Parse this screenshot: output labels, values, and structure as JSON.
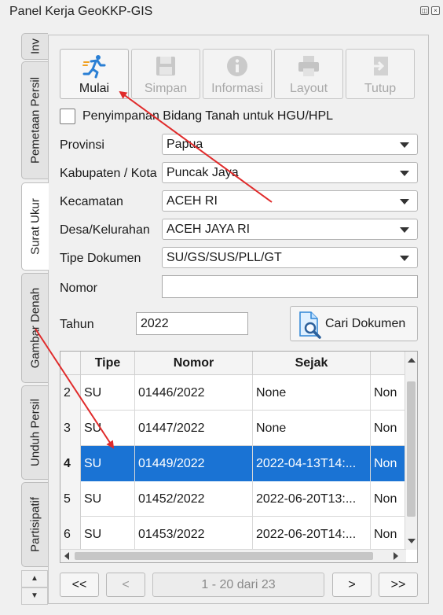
{
  "window": {
    "title": "Panel Kerja GeoKKP-GIS"
  },
  "tabs": [
    {
      "label": "Inv"
    },
    {
      "label": "Pemetaan Persil"
    },
    {
      "label": "Surat Ukur"
    },
    {
      "label": "Gambar Denah"
    },
    {
      "label": "Unduh Persil"
    },
    {
      "label": "Partisipatif"
    }
  ],
  "toolbar": {
    "mulai": "Mulai",
    "simpan": "Simpan",
    "informasi": "Informasi",
    "layout": "Layout",
    "tutup": "Tutup"
  },
  "form": {
    "hgu_checkbox_label": "Penyimpanan Bidang Tanah untuk HGU/HPL",
    "provinsi_label": "Provinsi",
    "provinsi_value": "Papua",
    "kabupaten_label": "Kabupaten / Kota",
    "kabupaten_value": "Puncak Jaya",
    "kecamatan_label": "Kecamatan",
    "kecamatan_value": "ACEH RI",
    "desa_label": "Desa/Kelurahan",
    "desa_value": "ACEH JAYA RI",
    "tipe_label": "Tipe Dokumen",
    "tipe_value": "SU/GS/SUS/PLL/GT",
    "nomor_label": "Nomor",
    "nomor_value": "",
    "tahun_label": "Tahun",
    "tahun_value": "2022",
    "cari_label": "Cari Dokumen"
  },
  "table": {
    "headers": [
      "Tipe",
      "Nomor",
      "Sejak"
    ],
    "rows": [
      {
        "no": "2",
        "tipe": "SU",
        "nomor": "01446/2022",
        "sejak": "None",
        "extra": "Non"
      },
      {
        "no": "3",
        "tipe": "SU",
        "nomor": "01447/2022",
        "sejak": "None",
        "extra": "Non"
      },
      {
        "no": "4",
        "tipe": "SU",
        "nomor": "01449/2022",
        "sejak": "2022-04-13T14:...",
        "extra": "Non"
      },
      {
        "no": "5",
        "tipe": "SU",
        "nomor": "01452/2022",
        "sejak": "2022-06-20T13:...",
        "extra": "Non"
      },
      {
        "no": "6",
        "tipe": "SU",
        "nomor": "01453/2022",
        "sejak": "2022-06-20T14:...",
        "extra": "Non"
      }
    ],
    "selected_row": "4"
  },
  "pager": {
    "first": "<<",
    "prev": "<",
    "info": "1 - 20 dari 23",
    "next": ">",
    "last": ">>"
  },
  "colors": {
    "selection": "#1a73d4",
    "annotation_arrow": "#e02b2b"
  }
}
